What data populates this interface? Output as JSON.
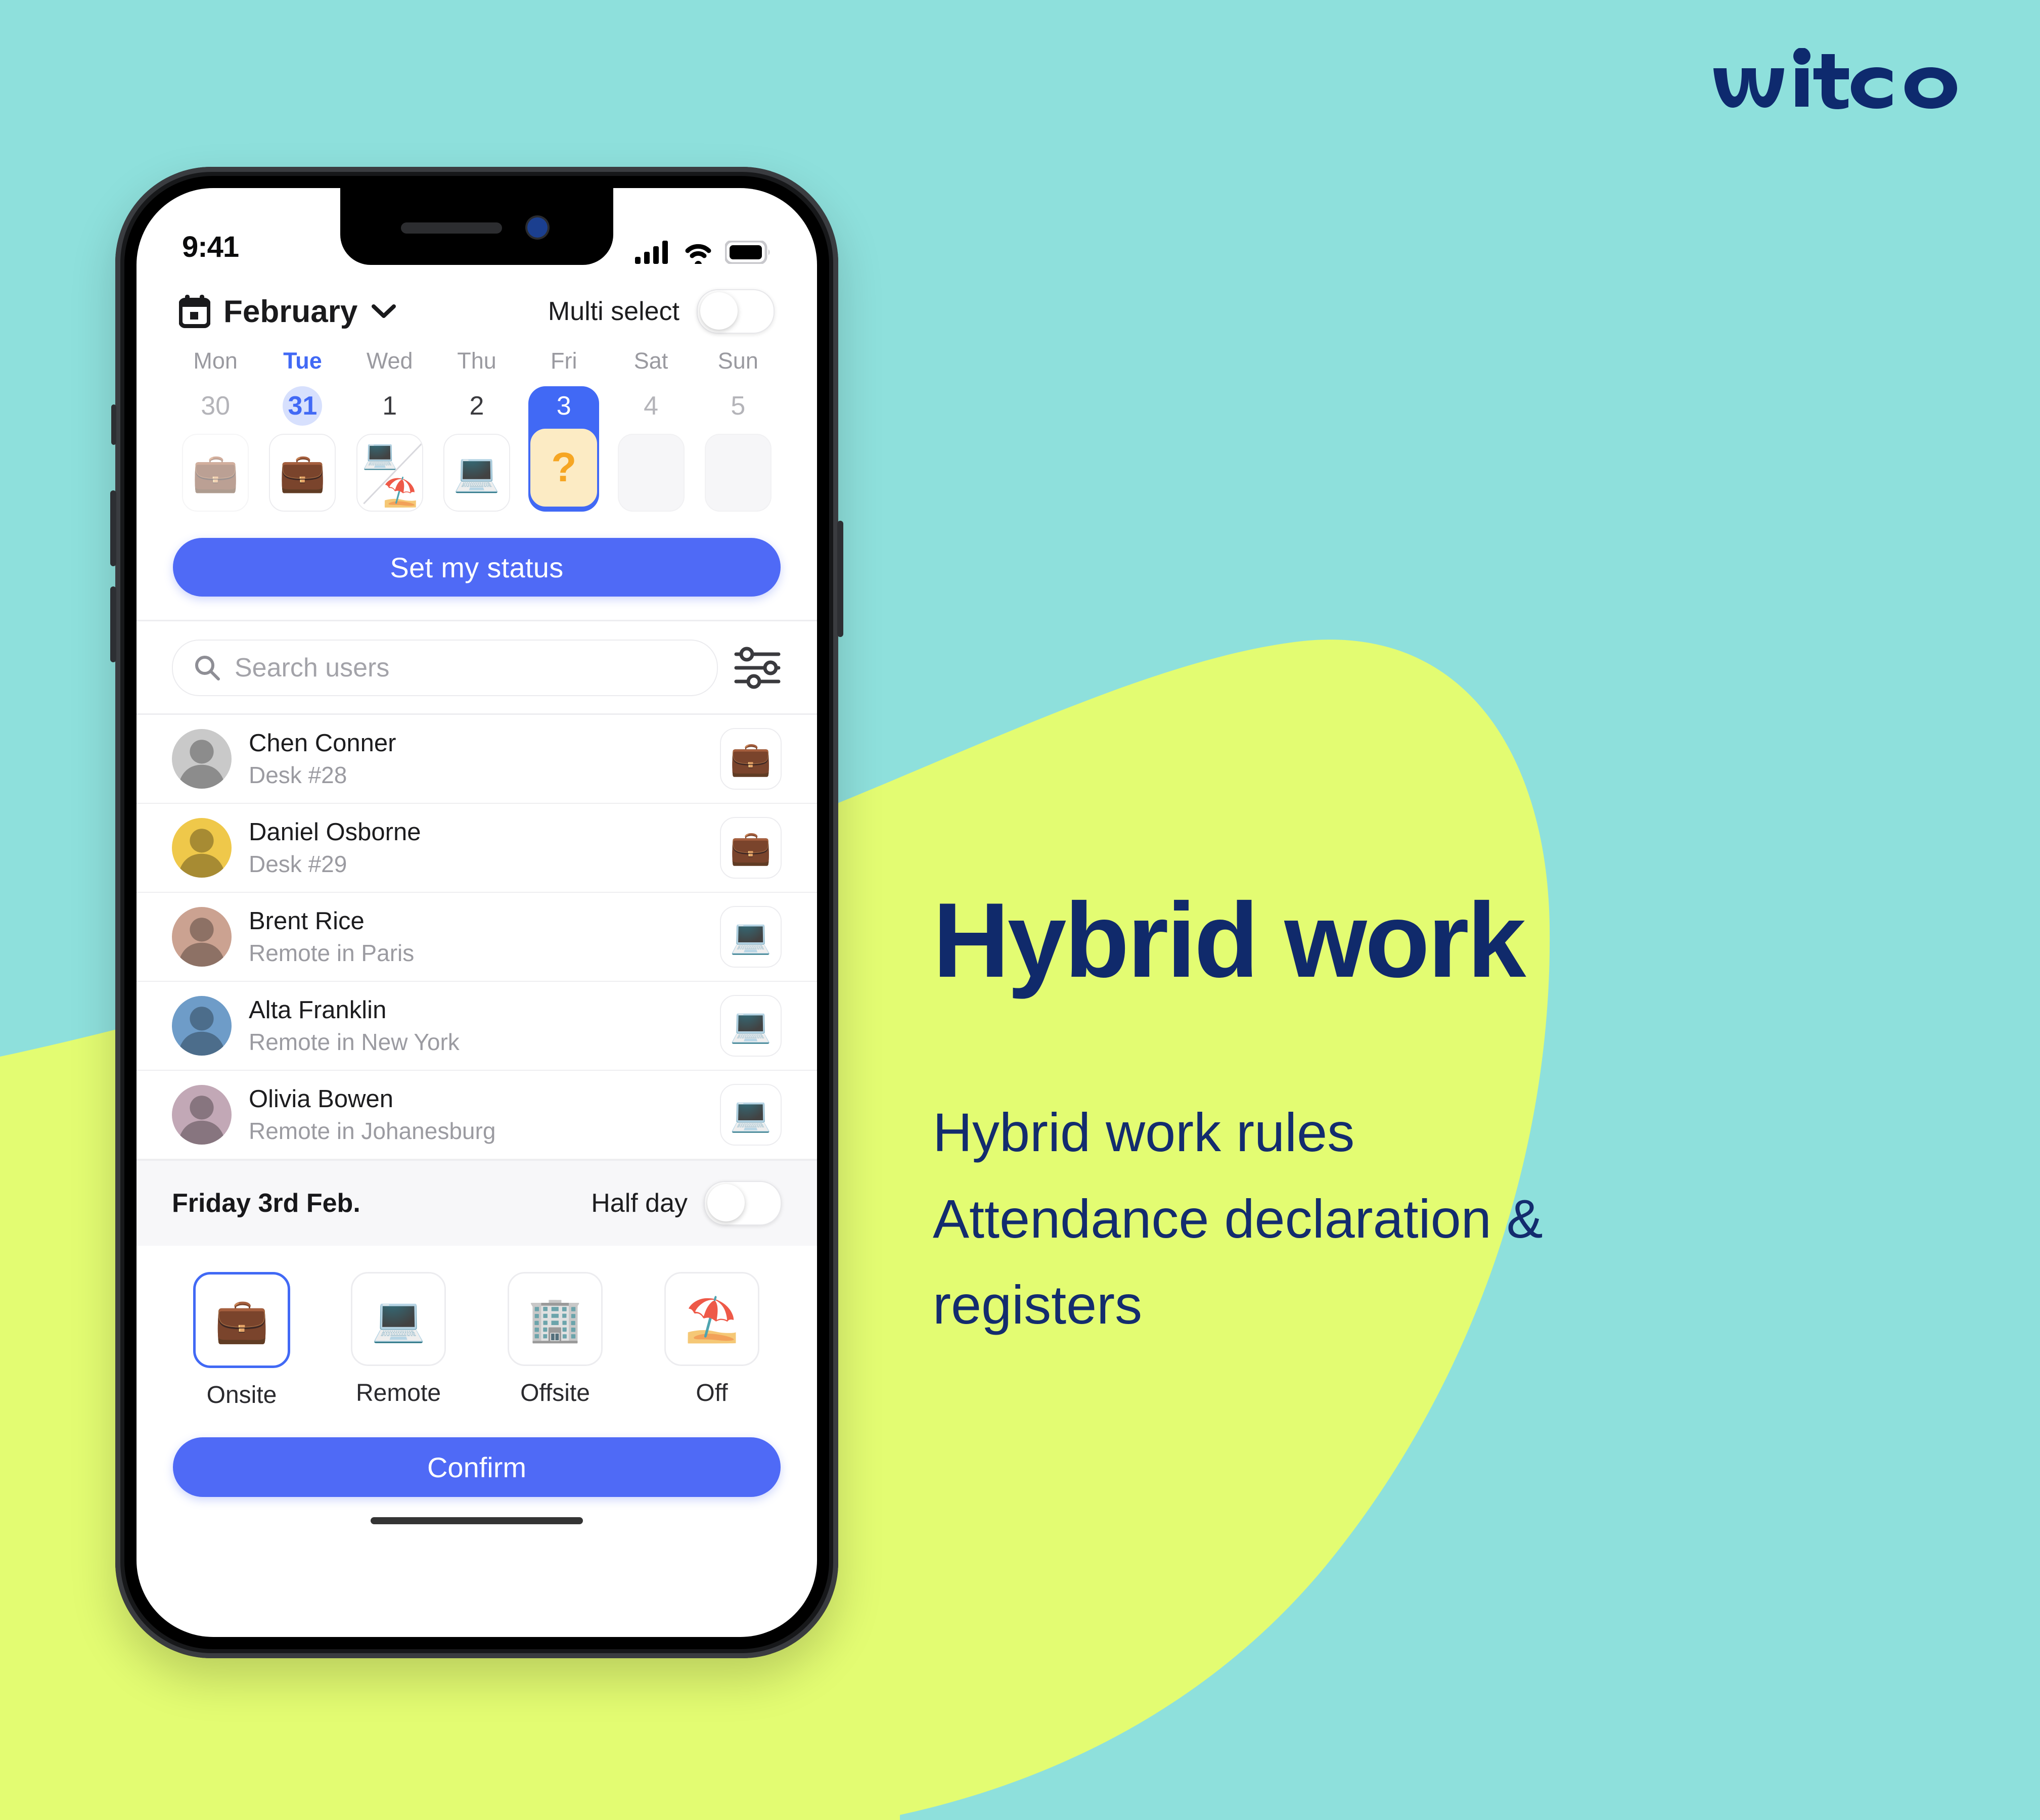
{
  "brand": {
    "logo_text": "witco",
    "navy": "#0E2A6E",
    "teal_bg": "#8EE0DC",
    "lime_blob": "#E3FC72",
    "accent_blue": "#4F6AF6"
  },
  "marketing": {
    "headline": "Hybrid work",
    "lines": [
      "Hybrid work rules",
      "Attendance declaration &",
      "registers"
    ]
  },
  "phone": {
    "status_bar": {
      "time": "9:41",
      "cellular_icon": "signal-bars-icon",
      "wifi_icon": "wifi-icon",
      "battery_icon": "battery-icon"
    },
    "header": {
      "calendar_icon": "calendar-icon",
      "month": "February",
      "chevron_icon": "chevron-down-icon",
      "multi_select_label": "Multi select",
      "multi_select_on": false
    },
    "week": {
      "days": [
        {
          "dow": "Mon",
          "num": "30",
          "active_dow": false,
          "today": false,
          "selected": false,
          "tile": "briefcase",
          "tile_emoji": "💼",
          "tile_state": "faded"
        },
        {
          "dow": "Tue",
          "num": "31",
          "active_dow": true,
          "today": true,
          "selected": false,
          "tile": "briefcase",
          "tile_emoji": "💼",
          "tile_state": "normal"
        },
        {
          "dow": "Wed",
          "num": "1",
          "active_dow": false,
          "today": false,
          "selected": false,
          "tile": "split-laptop-beach",
          "tile_emoji": "💻",
          "tile_emoji_b": "⛱️",
          "tile_state": "split"
        },
        {
          "dow": "Thu",
          "num": "2",
          "active_dow": false,
          "today": false,
          "selected": false,
          "tile": "laptop",
          "tile_emoji": "💻",
          "tile_state": "normal"
        },
        {
          "dow": "Fri",
          "num": "3",
          "active_dow": false,
          "today": false,
          "selected": true,
          "tile": "question",
          "tile_emoji": "?",
          "tile_state": "question"
        },
        {
          "dow": "Sat",
          "num": "4",
          "active_dow": false,
          "today": false,
          "selected": false,
          "tile": "none",
          "tile_emoji": "",
          "tile_state": "empty"
        },
        {
          "dow": "Sun",
          "num": "5",
          "active_dow": false,
          "today": false,
          "selected": false,
          "tile": "none",
          "tile_emoji": "",
          "tile_state": "empty"
        }
      ]
    },
    "set_status_button": "Set my status",
    "search": {
      "placeholder": "Search users",
      "value": "",
      "search_icon": "search-icon",
      "filter_icon": "filter-sliders-icon"
    },
    "users": [
      {
        "name": "Chen Conner",
        "detail": "Desk #28",
        "status_emoji": "💼",
        "status_name": "onsite",
        "avatar_bg": "#C9C9C9"
      },
      {
        "name": "Daniel Osborne",
        "detail": "Desk #29",
        "status_emoji": "💼",
        "status_name": "onsite",
        "avatar_bg": "#EFC84A"
      },
      {
        "name": "Brent Rice",
        "detail": "Remote in Paris",
        "status_emoji": "💻",
        "status_name": "remote",
        "avatar_bg": "#CBA291"
      },
      {
        "name": "Alta Franklin",
        "detail": "Remote in New York",
        "status_emoji": "💻",
        "status_name": "remote",
        "avatar_bg": "#6E9CC8"
      },
      {
        "name": "Olivia Bowen",
        "detail": "Remote in Johanesburg",
        "status_emoji": "💻",
        "status_name": "remote",
        "avatar_bg": "#C2A8B6"
      }
    ],
    "sheet": {
      "date": "Friday 3rd Feb.",
      "half_day_label": "Half day",
      "half_day_on": false,
      "options": [
        {
          "label": "Onsite",
          "emoji": "💼",
          "selected": true
        },
        {
          "label": "Remote",
          "emoji": "💻",
          "selected": false
        },
        {
          "label": "Offsite",
          "emoji": "🏢",
          "selected": false
        },
        {
          "label": "Off",
          "emoji": "⛱️",
          "selected": false
        }
      ],
      "confirm_button": "Confirm"
    }
  }
}
